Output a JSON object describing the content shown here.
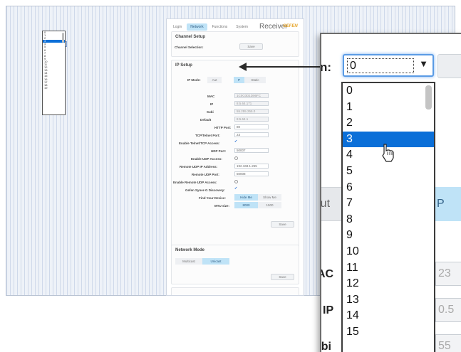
{
  "page": {
    "tabs": [
      {
        "label": "Login"
      },
      {
        "label": "Network",
        "active": true
      },
      {
        "label": "Functions"
      },
      {
        "label": "System"
      }
    ],
    "title": "Receiver",
    "brand": "GEFEN"
  },
  "channel_setup": {
    "title": "Channel Setup",
    "channel_label": "Channel Selection:",
    "channel_value": "0",
    "save_label": "Save"
  },
  "channel_dropdown": {
    "options": [
      "0",
      "1",
      "2",
      "3",
      "4",
      "5",
      "6",
      "7",
      "8",
      "9",
      "10",
      "11",
      "12",
      "13",
      "14",
      "15",
      "16",
      "17",
      "18",
      "19"
    ],
    "selected": "3"
  },
  "ip_setup": {
    "title": "IP Setup",
    "ip_mode_label": "IP Mode:",
    "ip_mode_options": [
      "Aut",
      "P",
      "Static"
    ],
    "mac_label": "MAC",
    "mac_value": "1C0C0D1D06FC",
    "ip_label": "IP",
    "ip_value": "8.5.64.171",
    "subnet_label": "Subi",
    "subnet_value": "55.255.255.0",
    "gateway_label": "Default",
    "gateway_value": "8.5.64.1",
    "http_label": "HTTP Port:",
    "http_value": "80",
    "telnet_label": "TCP/Telnet Port:",
    "telnet_value": "23",
    "enable_telnet_label": "Enable Telnet/TCP Access:",
    "udp_port_label": "UDP Port:",
    "udp_port_value": "50007",
    "enable_udp_label": "Enable UDP Access:",
    "remote_udp_ip_label": "Remote UDP IP Address:",
    "remote_udp_ip_value": "192.168.1.255",
    "remote_udp_port_label": "Remote UDP Port:",
    "remote_udp_port_value": "50008",
    "enable_remote_udp_label": "Enable Remote UDP Access:",
    "syner_g_label": "Gefen Syner-G Discovery:",
    "find_device_label": "Find Your Device:",
    "hide_me": "Hide Me",
    "show_me": "Show Me",
    "mtu_label": "MTU size:",
    "mtu_8000": "8000",
    "mtu_1500": "1500",
    "save_label": "Save"
  },
  "network_mode": {
    "title": "Network Mode",
    "multicast": "Multicast",
    "unicast": "Unicast",
    "save_label": "Save"
  },
  "zoom": {
    "top_label": "n:",
    "select_value": "0",
    "options": [
      "0",
      "1",
      "2",
      "3",
      "4",
      "5",
      "6",
      "7",
      "8",
      "9",
      "10",
      "11",
      "12",
      "13",
      "14",
      "15"
    ],
    "selected": "3",
    "side_labels": {
      "aut": "Aut",
      "mac": "AC",
      "ip": "IP",
      "subnet": "ubi"
    },
    "right_frags": {
      "p": "P",
      "mac": "23",
      "ip": "0.5",
      "sub": "55"
    }
  },
  "colors": {
    "accent": "#0b6fd8",
    "segment_on": "#bfe3f7",
    "focus_glow": "#5a9be5"
  }
}
